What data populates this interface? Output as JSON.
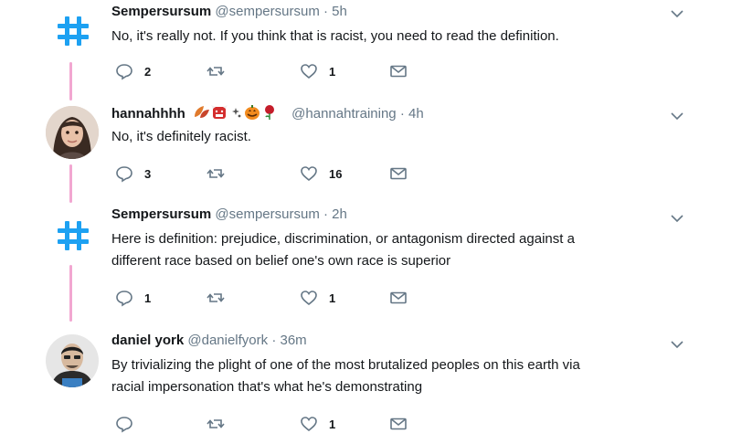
{
  "tweets": [
    {
      "name": "Sempersursum",
      "handle": "@sempersursum",
      "time": "5h",
      "emojis": [],
      "text_lines": [
        "No, it's really not. If you think that is racist, you need to read the definition."
      ],
      "replies": "2",
      "retweets": "",
      "likes": "1",
      "avatar": "hashtag-icon"
    },
    {
      "name": "hannahhhh",
      "handle": "@hannahtraining",
      "time": "4h",
      "emojis": [
        "leaves-emoji",
        "ogre-mask-emoji",
        "sparkles-emoji",
        "jack-o-lantern-emoji",
        "rose-emoji"
      ],
      "text_lines": [
        "No, it's definitely racist."
      ],
      "replies": "3",
      "retweets": "",
      "likes": "16",
      "avatar": "user-photo"
    },
    {
      "name": "Sempersursum",
      "handle": "@sempersursum",
      "time": "2h",
      "emojis": [],
      "text_lines": [
        "Here is definition: prejudice, discrimination, or antagonism directed against a",
        "different race based on belief one's own race is superior"
      ],
      "replies": "1",
      "retweets": "",
      "likes": "1",
      "avatar": "hashtag-icon"
    },
    {
      "name": "daniel york",
      "handle": "@danielfyork",
      "time": "36m",
      "emojis": [],
      "text_lines": [
        "By trivializing the plight of one of the most brutalized peoples on this earth via",
        "racial impersonation that's what he's demonstrating"
      ],
      "replies": "",
      "retweets": "",
      "likes": "1",
      "avatar": "user-photo"
    }
  ],
  "separator": "·",
  "colors": {
    "accent": "#1da1f2",
    "thread_line": "#f2a7d1",
    "muted": "#657786"
  }
}
